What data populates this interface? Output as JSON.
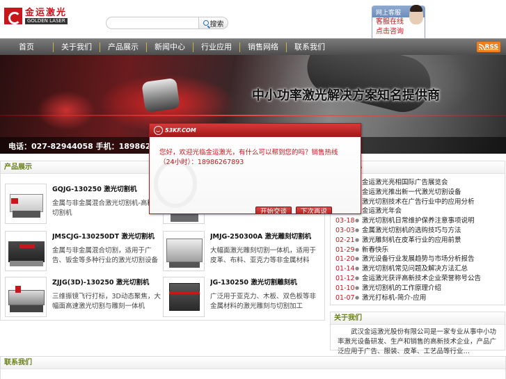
{
  "header": {
    "logo_cn": "金运激光",
    "logo_en": "GOLDEN LASER",
    "search_placeholder": "",
    "search_button": "搜索"
  },
  "service": {
    "title": "网上客服",
    "links": [
      "客服在线",
      "点击咨询"
    ]
  },
  "nav": {
    "items": [
      "首页",
      "关于我们",
      "产品展示",
      "新闻中心",
      "行业应用",
      "销售网络",
      "联系我们"
    ],
    "rss": "RSS"
  },
  "banner": {
    "slogan": "中小功率激光解决方案知名提供商",
    "contact": "电话：027-82944058  手机：18986267893"
  },
  "products": {
    "title": "产品展示",
    "items": [
      {
        "name": "GQJG-130250 激光切割机",
        "desc": "金属与非金属混合激光切割机-高精度切割机"
      },
      {
        "name": "",
        "desc": ""
      },
      {
        "name": "JMSCJG-130250DT 激光切割机",
        "desc": "金属与非金属混合切割，适用于广告、钣金等多种行业的激光切割设备"
      },
      {
        "name": "JMJG-250300A 激光雕刻切割机",
        "desc": "大幅面激光雕刻切割一体机，适用于皮革、布料、亚克力等非金属材料"
      },
      {
        "name": "ZJJG(3D)-130250 激光切割机",
        "desc": "三维振镜飞行打标，3D动态聚焦，大幅面高速激光切割与雕刻一体机"
      },
      {
        "name": "JG-130250 激光切割雕刻机",
        "desc": "广泛用于亚克力、木板、双色板等非金属材料的激光雕刻与切割加工"
      }
    ]
  },
  "news": {
    "title": "新闻中心",
    "items": [
      {
        "date": "",
        "title": "金运激光亮相国际广告展览会"
      },
      {
        "date": "",
        "title": "金运激光推出新一代激光切割设备"
      },
      {
        "date": "",
        "title": "激光切割技术在广告行业中的应用分析"
      },
      {
        "date": "",
        "title": "金运激光年会"
      },
      {
        "date": "03-18",
        "title": "激光切割机日常维护保养注意事项说明"
      },
      {
        "date": "03-03",
        "title": "金属激光切割机的选购技巧与方法"
      },
      {
        "date": "02-21",
        "title": "激光雕刻机在皮革行业的应用前景"
      },
      {
        "date": "01-29",
        "title": "新春快乐"
      },
      {
        "date": "01-20",
        "title": "激光设备行业发展趋势与市场分析报告"
      },
      {
        "date": "01-14",
        "title": "激光切割机常见问题及解决方法汇总"
      },
      {
        "date": "01-12",
        "title": "金运激光获评高新技术企业荣誉称号公告"
      },
      {
        "date": "01-10",
        "title": "激光切割机的工作原理介绍"
      },
      {
        "date": "01-07",
        "title": "激光打标机-简介-应用"
      }
    ]
  },
  "about": {
    "title": "关于我们",
    "text": "武汉金运激光股份有限公司是一家专业从事中小功率激光设备研发、生产和销售的高新技术企业，产品广泛应用于广告、服装、皮革、工艺品等行业…"
  },
  "bottom": {
    "title": "联系我们"
  },
  "dialog": {
    "brand": "53KF.COM",
    "message": "您好，欢迎光临金运激光，有什么可以帮到您的吗？销售热线（24小时）：18986267893",
    "btn_start": "开始交谈",
    "btn_later": "下次再说"
  },
  "colors": {
    "brand_red": "#c8161d",
    "nav_bg": "#5a5a5a",
    "panel_head_text": "#6a7f1d"
  }
}
